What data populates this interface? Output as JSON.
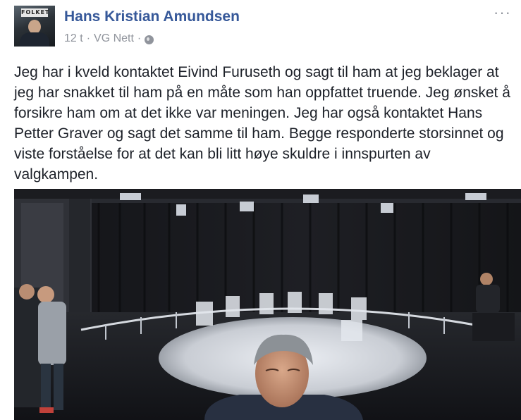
{
  "post": {
    "author": "Hans Kristian Amundsen",
    "time": "12 t",
    "separator": "·",
    "source": "VG Nett",
    "separator2": "·",
    "privacy_icon": "globe-icon",
    "more_label": "···",
    "avatar_sign": "FOLKET",
    "text": "Jeg har i kveld kontaktet Eivind Furuseth og sagt til ham at jeg beklager at jeg har snakket til ham på en måte som han oppfattet truende. Jeg ønsket å forsikre ham om at det ikke var meningen. Jeg har også kontaktet Hans Petter Graver og sagt det samme til ham. Begge responderte storsinnet og viste forståelse for at det kan bli litt høye skuldre i innspurten av valgkampen."
  },
  "colors": {
    "author": "#365899",
    "meta": "#90949c",
    "text": "#1d2129"
  }
}
